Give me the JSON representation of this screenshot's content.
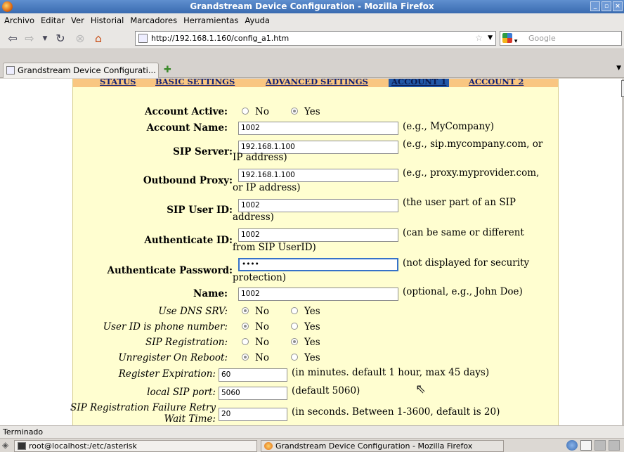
{
  "window": {
    "title": "Grandstream Device Configuration - Mozilla Firefox"
  },
  "menu": [
    "Archivo",
    "Editar",
    "Ver",
    "Historial",
    "Marcadores",
    "Herramientas",
    "Ayuda"
  ],
  "toolbar": {
    "url": "http://192.168.1.160/config_a1.htm",
    "search_placeholder": "Google"
  },
  "tabs": [
    {
      "label": "Grandstream Device Configurati..."
    }
  ],
  "page": {
    "nav": {
      "status": "STATUS",
      "basic": "BASIC SETTINGS",
      "advanced": "ADVANCED SETTINGS",
      "account1": "ACCOUNT 1",
      "account2": "ACCOUNT 2"
    },
    "account_active": {
      "label": "Account Active:",
      "no": "No",
      "yes": "Yes",
      "selected": "Yes"
    },
    "account_name": {
      "label": "Account Name:",
      "value": "1002",
      "hint": "(e.g., MyCompany)"
    },
    "sip_server": {
      "label": "SIP Server:",
      "value": "192.168.1.100",
      "hint": "(e.g., sip.mycompany.com, or",
      "hint2": "IP address)"
    },
    "outbound_proxy": {
      "label": "Outbound Proxy:",
      "value": "192.168.1.100",
      "hint": "(e.g., proxy.myprovider.com,",
      "hint2": "or IP address)"
    },
    "sip_user_id": {
      "label": "SIP User ID:",
      "value": "1002",
      "hint": "(the user part of an SIP",
      "hint2": "address)"
    },
    "authenticate_id": {
      "label": "Authenticate ID:",
      "value": "1002",
      "hint": "(can be same or different",
      "hint2": "from SIP UserID)"
    },
    "authenticate_password": {
      "label": "Authenticate Password:",
      "value": "••••",
      "hint": "(not displayed for security",
      "hint2": "protection)"
    },
    "name": {
      "label": "Name:",
      "value": "1002",
      "hint": "(optional, e.g., John Doe)"
    },
    "use_dns_srv": {
      "label": "Use DNS SRV:",
      "no": "No",
      "yes": "Yes",
      "selected": "No"
    },
    "user_id_phone": {
      "label": "User ID is phone number:",
      "no": "No",
      "yes": "Yes",
      "selected": "No"
    },
    "sip_registration": {
      "label": "SIP Registration:",
      "no": "No",
      "yes": "Yes",
      "selected": "Yes"
    },
    "unregister_reboot": {
      "label": "Unregister On Reboot:",
      "no": "No",
      "yes": "Yes",
      "selected": "No"
    },
    "register_expiration": {
      "label": "Register Expiration:",
      "value": "60",
      "hint": "(in minutes. default 1 hour, max 45 days)"
    },
    "local_sip_port": {
      "label": "local SIP port:",
      "value": "5060",
      "hint": "(default 5060)"
    },
    "retry_wait": {
      "label": "SIP Registration Failure Retry",
      "label2": "Wait Time:",
      "value": "20",
      "hint": "(in seconds. Between 1-3600, default is 20)"
    }
  },
  "status": "Terminado",
  "taskbar": {
    "task1": "root@localhost:/etc/asterisk",
    "task2": "Grandstream Device Configuration - Mozilla Firefox"
  }
}
